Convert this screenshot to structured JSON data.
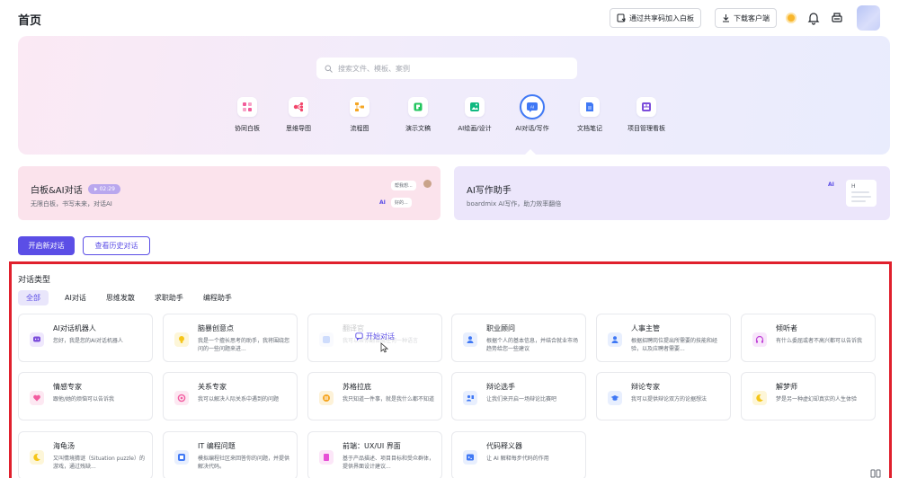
{
  "header": {
    "title": "首页",
    "join_label": "通过共享码加入白板",
    "download_label": "下载客户端"
  },
  "search": {
    "placeholder": "搜索文件、模板、案例"
  },
  "tools": [
    {
      "label": "协同白板",
      "icon": "whiteboard-icon",
      "color": "#f25c9a"
    },
    {
      "label": "思维导图",
      "icon": "mindmap-icon",
      "color": "#f2456a"
    },
    {
      "label": "流程图",
      "icon": "flowchart-icon",
      "color": "#f5a623"
    },
    {
      "label": "演示文稿",
      "icon": "presentation-icon",
      "color": "#22c55e"
    },
    {
      "label": "AI绘画/设计",
      "icon": "ai-painting-icon",
      "color": "#10b981"
    },
    {
      "label": "AI对话/写作",
      "icon": "ai-chat-icon",
      "color": "#3f78f5"
    },
    {
      "label": "文档笔记",
      "icon": "document-icon",
      "color": "#3f78f5"
    },
    {
      "label": "项目管理看板",
      "icon": "kanban-icon",
      "color": "#7c4ddb"
    }
  ],
  "cards": {
    "whiteboard_ai": {
      "title": "白板&AI对话",
      "duration": "02:29",
      "subtitle": "无限白板，书写未来，对话AI",
      "bubble1": "帮我想...",
      "bubble2": "好的..."
    },
    "ai_writing": {
      "title": "AI写作助手",
      "subtitle": "boardmix AI写作，助力效率翻倍",
      "doc_mark": "AI",
      "doc_head": "H"
    }
  },
  "actions": {
    "new_chat": "开启新对话",
    "history": "查看历史对话"
  },
  "section": {
    "title": "对话类型",
    "tabs": [
      "全部",
      "AI对话",
      "思维发散",
      "求职助手",
      "编程助手"
    ],
    "start_chat": "开始对话",
    "templates": [
      {
        "name": "AI对话机器人",
        "desc": "您好，我是您的AI对话机器人",
        "color": "#7c4ddb",
        "icon": "chatbot-icon"
      },
      {
        "name": "脑暴创意点",
        "desc": "我是一个擅长思考的助手，我将围绕您问的一些问题来进...",
        "color": "#f5c518",
        "icon": "lightbulb-icon"
      },
      {
        "name": "翻译官",
        "desc": "我可以帮你翻译成任何一种语言",
        "color": "#3f78f5",
        "icon": "translate-icon"
      },
      {
        "name": "职业顾问",
        "desc": "根据个人的基本信息，并结合就业市场趋势给您一些建议",
        "color": "#3f78f5",
        "icon": "person-icon"
      },
      {
        "name": "人事主管",
        "desc": "根据招聘岗位提出所需要的技能和经验，以及应聘者需要...",
        "color": "#3f78f5",
        "icon": "hr-person-icon"
      },
      {
        "name": "倾听者",
        "desc": "有什么委屈或者不高兴都可以告诉我",
        "color": "#c248d8",
        "icon": "headphone-icon"
      },
      {
        "name": "情感专家",
        "desc": "跟他/她的烦恼可以告诉我",
        "color": "#f25ca0",
        "icon": "heart-icon"
      },
      {
        "name": "关系专家",
        "desc": "我可以解决人际关系中遇到的问题",
        "color": "#f25ca0",
        "icon": "relation-icon"
      },
      {
        "name": "苏格拉底",
        "desc": "我只知道一件事，就是我什么都不知道",
        "color": "#f5a623",
        "icon": "pause-icon"
      },
      {
        "name": "辩论选手",
        "desc": "让我们来开启一场辩论比赛吧",
        "color": "#3f78f5",
        "icon": "debater-icon"
      },
      {
        "name": "辩论专家",
        "desc": "我可以提供辩论双方的论据想法",
        "color": "#3f78f5",
        "icon": "grad-cap-icon"
      },
      {
        "name": "解梦师",
        "desc": "梦是另一种虚幻却真实的人生体验",
        "color": "#f5c518",
        "icon": "moon-icon"
      },
      {
        "name": "海龟汤",
        "desc": "又叫情境猜谜（Situation puzzle）的游戏，通过残缺...",
        "color": "#f5c518",
        "icon": "turtle-soup-icon"
      },
      {
        "name": "IT 编程问题",
        "desc": "模拟编程社区来回答你的问题，并提供解决代码。",
        "color": "#3f78f5",
        "icon": "code-icon"
      },
      {
        "name": "前端：UX/UI 界面",
        "desc": "基于产品描述、项目目标和受众群体，提供界面设计建议...",
        "color": "#e74fd6",
        "icon": "ui-icon"
      },
      {
        "name": "代码释义器",
        "desc": "让 AI 解释每步代码的作用",
        "color": "#3f78f5",
        "icon": "code-explain-icon"
      }
    ]
  }
}
